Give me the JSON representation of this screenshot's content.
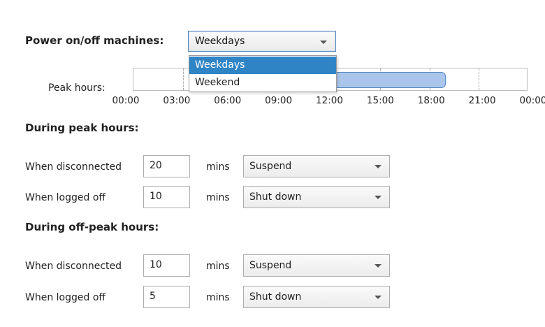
{
  "power": {
    "label": "Power on/off machines:",
    "selected": "Weekdays",
    "options": [
      "Weekdays",
      "Weekend"
    ]
  },
  "timeline": {
    "label": "Peak hours:",
    "ticks": [
      "00:00",
      "03:00",
      "06:00",
      "09:00",
      "12:00",
      "15:00",
      "18:00",
      "21:00",
      "00:00"
    ],
    "peak_start_hour": 7,
    "peak_end_hour": 19,
    "bar_color": "#a9c6ea",
    "bar_border": "#5b88c2"
  },
  "peak": {
    "heading": "During peak hours:",
    "rows": [
      {
        "label": "When disconnected",
        "minutes": "20",
        "unit": "mins",
        "action": "Suspend"
      },
      {
        "label": "When logged off",
        "minutes": "10",
        "unit": "mins",
        "action": "Shut down"
      }
    ]
  },
  "offpeak": {
    "heading": "During off-peak hours:",
    "rows": [
      {
        "label": "When disconnected",
        "minutes": "10",
        "unit": "mins",
        "action": "Suspend"
      },
      {
        "label": "When logged off",
        "minutes": "5",
        "unit": "mins",
        "action": "Shut down"
      }
    ]
  },
  "colors": {
    "selection": "#2f84c5",
    "focus_border": "#5a86b8"
  }
}
